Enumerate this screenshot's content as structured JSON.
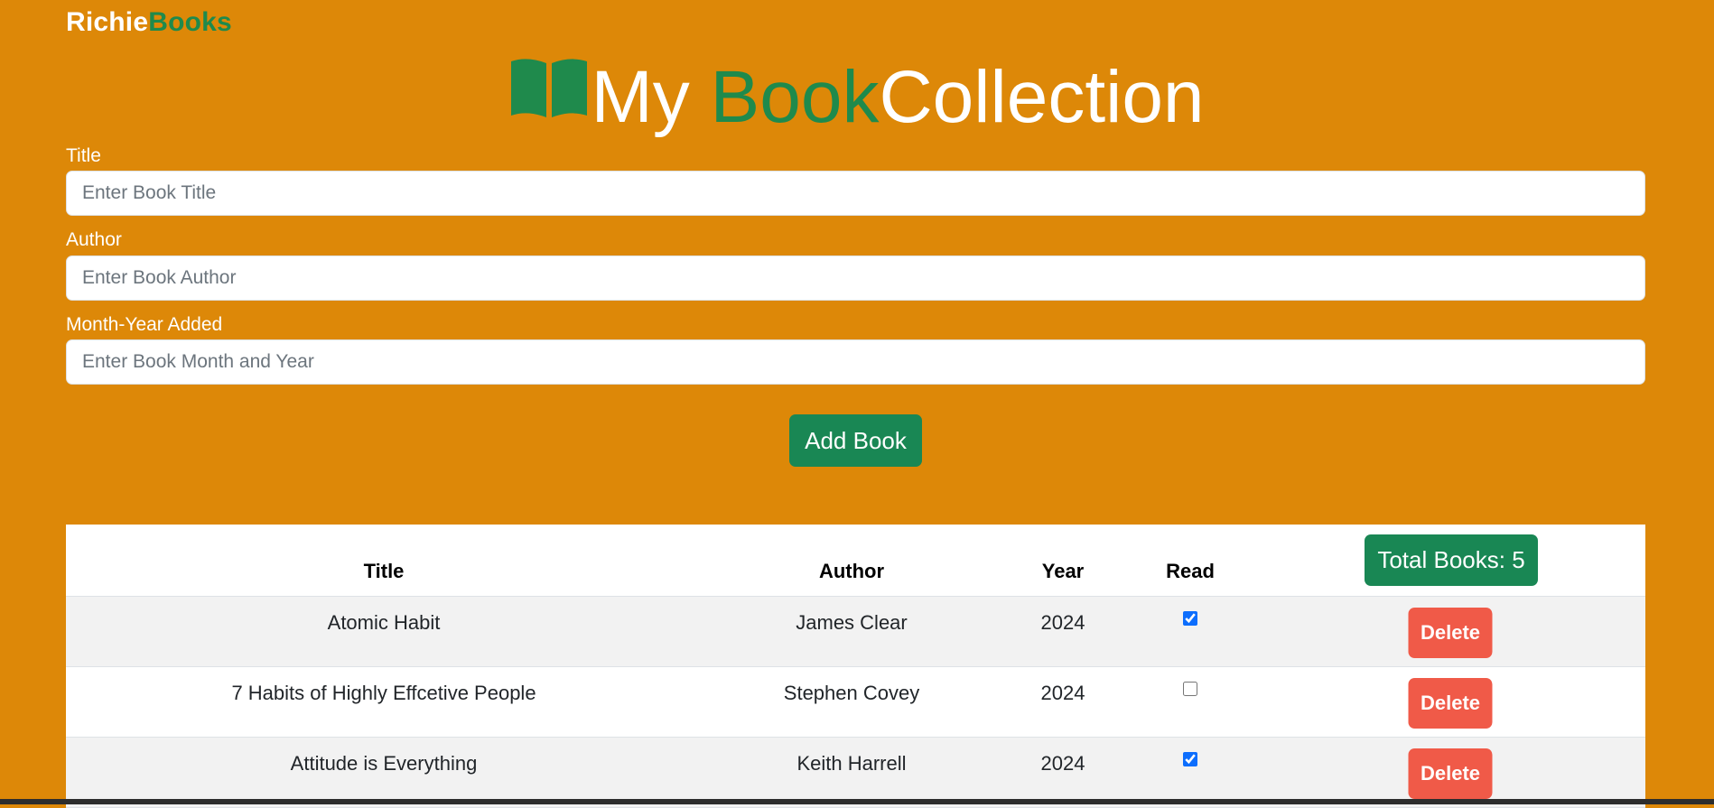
{
  "brand": {
    "part1": "Richie",
    "part2": "Books"
  },
  "heading": {
    "icon": "book-open-icon",
    "part1": "My ",
    "part2": "Book",
    "part3": "Collection"
  },
  "form": {
    "title_label": "Title",
    "title_placeholder": "Enter Book Title",
    "title_value": "",
    "author_label": "Author",
    "author_placeholder": "Enter Book Author",
    "author_value": "",
    "date_label": "Month-Year Added",
    "date_placeholder": "Enter Book Month and Year",
    "date_value": "",
    "add_button": "Add Book"
  },
  "table": {
    "total_label": "Total Books: 5",
    "headers": {
      "title": "Title",
      "author": "Author",
      "year": "Year",
      "read": "Read"
    },
    "rows": [
      {
        "title": "Atomic Habit",
        "author": "James Clear",
        "year": "2024",
        "read": true,
        "delete_label": "Delete"
      },
      {
        "title": "7 Habits of Highly Effcetive People",
        "author": "Stephen Covey",
        "year": "2024",
        "read": false,
        "delete_label": "Delete"
      },
      {
        "title": "Attitude is Everything",
        "author": "Keith Harrell",
        "year": "2024",
        "read": true,
        "delete_label": "Delete"
      }
    ]
  },
  "colors": {
    "background": "#dd8808",
    "brand_green": "#1f8a4c",
    "button_green": "#198754",
    "delete_red": "#f05a48"
  }
}
